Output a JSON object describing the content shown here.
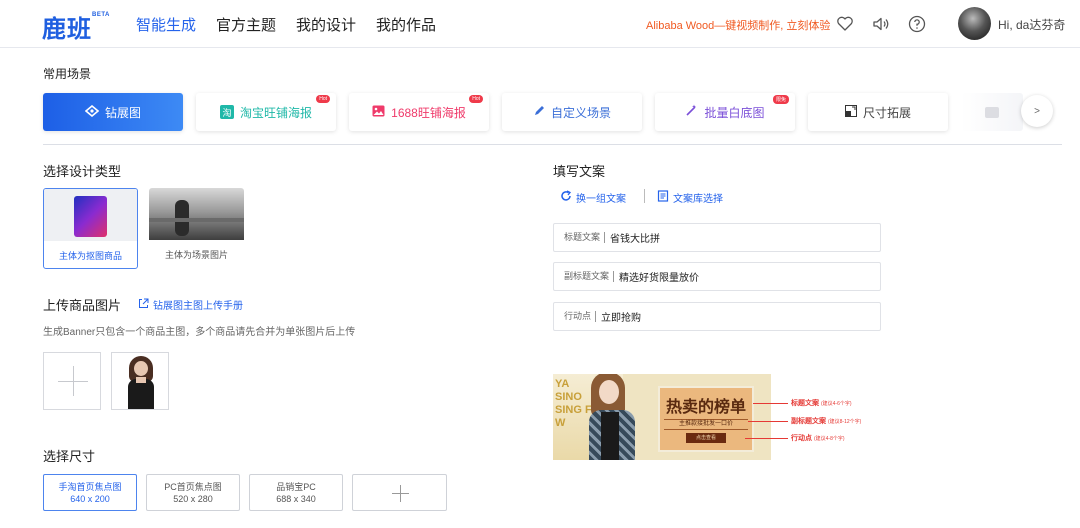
{
  "header": {
    "logo": "鹿班",
    "beta": "BETA",
    "nav": [
      "智能生成",
      "官方主题",
      "我的设计",
      "我的作品"
    ],
    "promo": "Alibaba Wood—键视频制作, 立刻体验",
    "icons": [
      "heart-icon",
      "speaker-icon",
      "help-icon"
    ],
    "username": "Hi, da达芬奇"
  },
  "scenes": {
    "title": "常用场景",
    "items": [
      {
        "label": "钻展图",
        "icon": "eye-icon",
        "active": true
      },
      {
        "label": "淘宝旺铺海报",
        "icon": "taobao-icon",
        "badge": "Hot"
      },
      {
        "label": "1688旺铺海报",
        "icon": "image-icon",
        "badge": "Hot"
      },
      {
        "label": "自定义场景",
        "icon": "pen-icon"
      },
      {
        "label": "批量白底图",
        "icon": "magic-wand-icon",
        "badge": "限免"
      },
      {
        "label": "尺寸拓展",
        "icon": "resize-icon"
      }
    ],
    "next": ">"
  },
  "design_type": {
    "title": "选择设计类型",
    "cards": [
      {
        "label": "主体为抠图商品",
        "selected": true
      },
      {
        "label": "主体为场景图片",
        "selected": false
      }
    ]
  },
  "upload": {
    "title": "上传商品图片",
    "manual_link": "钻展图主图上传手册",
    "hint": "生成Banner只包含一个商品主图，多个商品请先合并为单张图片后上传"
  },
  "size": {
    "title": "选择尺寸",
    "options": [
      {
        "name": "手淘首页焦点图",
        "dims": "640 x 200",
        "selected": true
      },
      {
        "name": "PC首页焦点图",
        "dims": "520 x 280",
        "selected": false
      },
      {
        "name": "品销宝PC",
        "dims": "688 x 340",
        "selected": false
      }
    ]
  },
  "copy": {
    "title": "填写文案",
    "swap": "换一组文案",
    "library": "文案库选择",
    "fields": [
      {
        "label": "标题文案",
        "value": "省钱大比拼"
      },
      {
        "label": "副标题文案",
        "value": "精选好货限量放价"
      },
      {
        "label": "行动点",
        "value": "立即抢购"
      }
    ]
  },
  "preview": {
    "side_text": [
      "YA",
      "SINO",
      "SING FO",
      "W"
    ],
    "title": "热卖的榜单",
    "subtitle": "主推款接批发一口价",
    "cta": "点击查看",
    "annotations": [
      {
        "name": "标题文案",
        "note": "(建议4-6个字)"
      },
      {
        "name": "副标题文案",
        "note": "(建议8-12个字)"
      },
      {
        "name": "行动点",
        "note": "(建议4-8个字)"
      }
    ]
  },
  "colors": {
    "accent": "#2563eb",
    "promo": "#f05a22",
    "annotation": "#e53935"
  }
}
